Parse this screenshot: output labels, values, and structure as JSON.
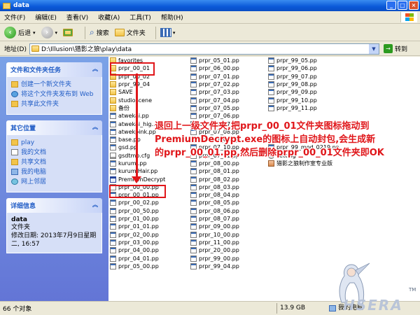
{
  "window": {
    "title": "data"
  },
  "menu": [
    "文件(F)",
    "编辑(E)",
    "查看(V)",
    "收藏(A)",
    "工具(T)",
    "帮助(H)"
  ],
  "toolbar": {
    "back": "后退",
    "search": "搜索",
    "folders": "文件夹"
  },
  "address": {
    "label": "地址(D)",
    "path": "D:\\Illusion\\猎影之狼\\play\\data",
    "go": "转到"
  },
  "tasks": {
    "file_tasks": {
      "title": "文件和文件夹任务",
      "items": [
        "创建一个新文件夹",
        "将这个文件夹发布到 Web",
        "共享此文件夹"
      ]
    },
    "other_places": {
      "title": "其它位置",
      "items": [
        "play",
        "我的文档",
        "共享文档",
        "我的电脑",
        "网上邻居"
      ]
    },
    "details": {
      "title": "详细信息",
      "name": "data",
      "type": "文件夹",
      "modified": "修改日期: 2013年7月9日星期二, 16:57"
    }
  },
  "files": {
    "col1": [
      {
        "name": "favorites",
        "icon": "folder"
      },
      {
        "name": "prpr_00_01",
        "icon": "folder"
      },
      {
        "name": "prpr_00_02",
        "icon": "folder"
      },
      {
        "name": "prpr_99_04",
        "icon": "folder"
      },
      {
        "name": "SAVE",
        "icon": "folder"
      },
      {
        "name": "studioscene",
        "icon": "folder"
      },
      {
        "name": "备份",
        "icon": "folder"
      },
      {
        "name": "atwekai.pp",
        "icon": "file"
      },
      {
        "name": "atwekai_hig...pp",
        "icon": "file"
      },
      {
        "name": "atwekpink.pp",
        "icon": "file"
      },
      {
        "name": "base.pp",
        "icon": "file"
      },
      {
        "name": "gsd.pp",
        "icon": "file"
      },
      {
        "name": "gsdtmp.cfg",
        "icon": "cfg"
      },
      {
        "name": "kurumi.pp",
        "icon": "file"
      },
      {
        "name": "kurumiHair.pp",
        "icon": "file"
      },
      {
        "name": "PremiumDecrypt",
        "icon": "exe"
      },
      {
        "name": "prpr_00_00.pp",
        "icon": "file"
      },
      {
        "name": "prpr_00_01.pp",
        "icon": "file"
      },
      {
        "name": "prpr_00_02.pp",
        "icon": "file"
      },
      {
        "name": "prpr_00_50.pp",
        "icon": "file"
      },
      {
        "name": "prpr_01_00.pp",
        "icon": "file"
      },
      {
        "name": "prpr_01_01.pp",
        "icon": "file"
      },
      {
        "name": "prpr_02_00.pp",
        "icon": "file"
      },
      {
        "name": "prpr_03_00.pp",
        "icon": "file"
      },
      {
        "name": "prpr_04_00.pp",
        "icon": "file"
      },
      {
        "name": "prpr_04_01.pp",
        "icon": "file"
      },
      {
        "name": "prpr_05_00.pp",
        "icon": "file"
      }
    ],
    "col2": [
      {
        "name": "prpr_05_01.pp",
        "icon": "file"
      },
      {
        "name": "prpr_06_00.pp",
        "icon": "file"
      },
      {
        "name": "prpr_07_01.pp",
        "icon": "file"
      },
      {
        "name": "prpr_07_02.pp",
        "icon": "file"
      },
      {
        "name": "prpr_07_03.pp",
        "icon": "file"
      },
      {
        "name": "prpr_07_04.pp",
        "icon": "file"
      },
      {
        "name": "prpr_07_05.pp",
        "icon": "file"
      },
      {
        "name": "prpr_07_06.pp",
        "icon": "file"
      },
      {
        "name": "prpr_07_07.pp",
        "icon": "file"
      },
      {
        "name": "prpr_07_08.pp",
        "icon": "file"
      },
      {
        "name": "prpr_07_09.pp",
        "icon": "file"
      },
      {
        "name": "prpr_07_10.pp",
        "icon": "file"
      },
      {
        "name": "prpr_07_11.pp",
        "icon": "file"
      },
      {
        "name": "prpr_08_00.pp",
        "icon": "file"
      },
      {
        "name": "prpr_08_01.pp",
        "icon": "file"
      },
      {
        "name": "prpr_08_02.pp",
        "icon": "file"
      },
      {
        "name": "prpr_08_03.pp",
        "icon": "file"
      },
      {
        "name": "prpr_08_04.pp",
        "icon": "file"
      },
      {
        "name": "prpr_08_05.pp",
        "icon": "file"
      },
      {
        "name": "prpr_08_06.pp",
        "icon": "file"
      },
      {
        "name": "prpr_08_07.pp",
        "icon": "file"
      },
      {
        "name": "prpr_09_00.pp",
        "icon": "file"
      },
      {
        "name": "prpr_10_00.pp",
        "icon": "file"
      },
      {
        "name": "prpr_11_00.pp",
        "icon": "file"
      },
      {
        "name": "prpr_20_00.pp",
        "icon": "file"
      },
      {
        "name": "prpr_99_00.pp",
        "icon": "file"
      },
      {
        "name": "prpr_99_04.pp",
        "icon": "file"
      }
    ],
    "col3": [
      {
        "name": "prpr_99_05.pp",
        "icon": "file"
      },
      {
        "name": "prpr_99_06.pp",
        "icon": "file"
      },
      {
        "name": "prpr_99_07.pp",
        "icon": "file"
      },
      {
        "name": "prpr_99_08.pp",
        "icon": "file"
      },
      {
        "name": "prpr_99_09.pp",
        "icon": "file"
      },
      {
        "name": "prpr_99_10.pp",
        "icon": "file"
      },
      {
        "name": "prpr_99_11.pp",
        "icon": "file"
      },
      {
        "name": "",
        "icon": "none"
      },
      {
        "name": "",
        "icon": "none"
      },
      {
        "name": "",
        "icon": "none"
      },
      {
        "name": "",
        "icon": "none"
      },
      {
        "name": "prpr_99_mod_0219.pp",
        "icon": "file"
      },
      {
        "name": "setting",
        "icon": "gear"
      },
      {
        "name": "猎影之狼制作室专业版",
        "icon": "avatar"
      }
    ]
  },
  "annotation": {
    "line1": "退回上一级文件夹,把prpr_00_01文件夹图标拖动到",
    "line2": "PremiumDecrypt.exe的图标上自动封包,会生成新",
    "line3": "的prpr_00_01.pp,然后删除prpr_00_01文件夹即OK"
  },
  "status": {
    "count": "66 个对象",
    "size": "13.9 GB",
    "location": "我的电脑"
  },
  "watermark": {
    "text": "HSERA",
    "tm": "TM"
  },
  "colors": {
    "highlight": "#e0161a",
    "title_bar": "#0a58d8",
    "link": "#215dc6"
  }
}
